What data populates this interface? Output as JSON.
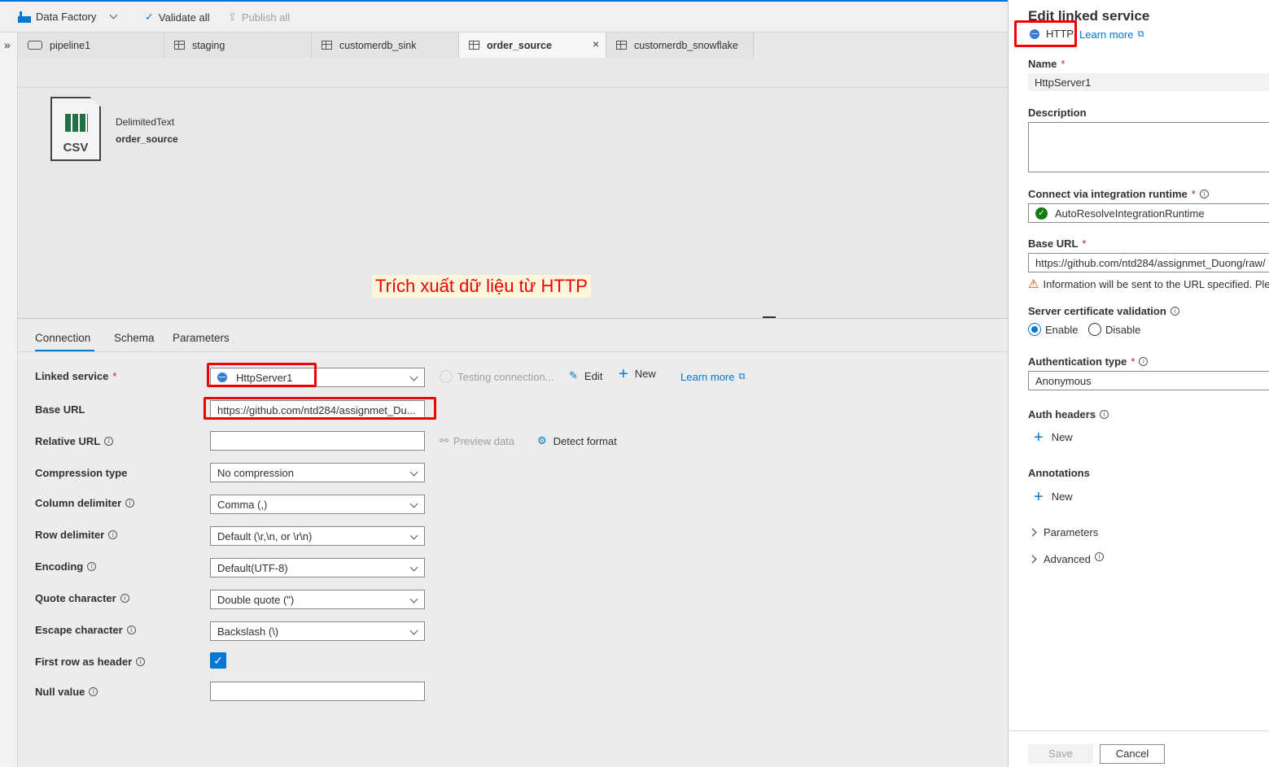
{
  "topbar": {
    "factory": "Data Factory",
    "validate": "Validate all",
    "publish": "Publish all"
  },
  "tabs": [
    {
      "label": "pipeline1"
    },
    {
      "label": "staging"
    },
    {
      "label": "customerdb_sink"
    },
    {
      "label": "order_source"
    },
    {
      "label": "customerdb_snowflake"
    }
  ],
  "dataset": {
    "icon_text": "CSV",
    "type": "DelimitedText",
    "name": "order_source"
  },
  "annotation": "Trích xuất dữ liệu từ HTTP",
  "subtabs": [
    "Connection",
    "Schema",
    "Parameters"
  ],
  "form": {
    "linked_service": {
      "label": "Linked service",
      "value": "HttpServer1",
      "testing": "Testing connection...",
      "edit": "Edit",
      "new": "New",
      "learn_more": "Learn more"
    },
    "base_url": {
      "label": "Base URL",
      "value": "https://github.com/ntd284/assignmet_Du..."
    },
    "relative_url": {
      "label": "Relative URL",
      "value": "",
      "preview": "Preview data",
      "detect": "Detect format"
    },
    "compression": {
      "label": "Compression type",
      "value": "No compression"
    },
    "column_delim": {
      "label": "Column delimiter",
      "value": "Comma (,)"
    },
    "row_delim": {
      "label": "Row delimiter",
      "value": "Default (\\r,\\n, or \\r\\n)"
    },
    "encoding": {
      "label": "Encoding",
      "value": "Default(UTF-8)"
    },
    "quote": {
      "label": "Quote character",
      "value": "Double quote (\")"
    },
    "escape": {
      "label": "Escape character",
      "value": "Backslash (\\)"
    },
    "first_row": {
      "label": "First row as header",
      "checked": true
    },
    "null_value": {
      "label": "Null value",
      "value": ""
    }
  },
  "panel": {
    "title": "Edit linked service",
    "type": "HTTP",
    "learn_more": "Learn more",
    "name_label": "Name",
    "name_value": "HttpServer1",
    "desc_label": "Description",
    "runtime_label": "Connect via integration runtime",
    "runtime_value": "AutoResolveIntegrationRuntime",
    "base_url_label": "Base URL",
    "base_url_value": "https://github.com/ntd284/assignmet_Duong/raw/",
    "warning": "Information will be sent to the URL specified. Ple",
    "cert_label": "Server certificate validation",
    "enable": "Enable",
    "disable": "Disable",
    "auth_label": "Authentication type",
    "auth_value": "Anonymous",
    "headers_label": "Auth headers",
    "new": "New",
    "annotations_label": "Annotations",
    "parameters": "Parameters",
    "advanced": "Advanced",
    "save": "Save",
    "cancel": "Cancel"
  },
  "colors": {
    "accent": "#0078d4",
    "highlight": "#e00000"
  }
}
